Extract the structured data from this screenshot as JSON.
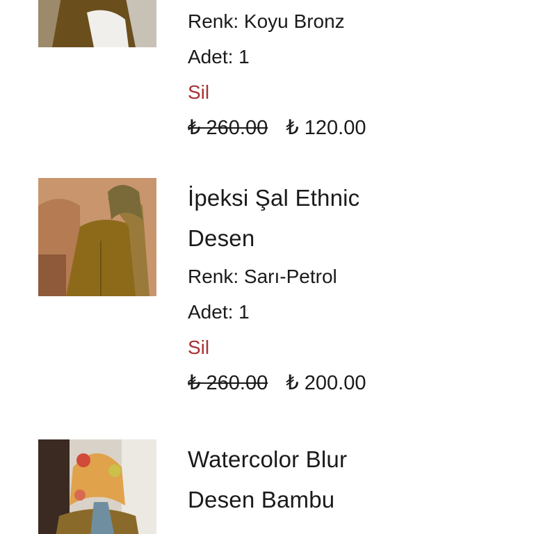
{
  "currency_symbol": "₺",
  "accent_colors": {
    "remove_link": "#a83235",
    "text": "#1a1a1a"
  },
  "items": [
    {
      "title": "",
      "color_label": "Renk: Koyu Bronz",
      "quantity_label": "Adet: 1",
      "remove_label": "Sil",
      "old_price": "₺ 260.00",
      "new_price": "₺ 120.00",
      "image_icon": "product-photo"
    },
    {
      "title_line1": "İpeksi Şal Ethnic",
      "title_line2": "Desen",
      "color_label": "Renk: Sarı-Petrol",
      "quantity_label": "Adet: 1",
      "remove_label": "Sil",
      "old_price": "₺ 260.00",
      "new_price": "₺ 200.00",
      "image_icon": "product-photo"
    },
    {
      "title_line1": "Watercolor Blur",
      "title_line2": "Desen Bambu",
      "image_icon": "product-photo"
    }
  ]
}
